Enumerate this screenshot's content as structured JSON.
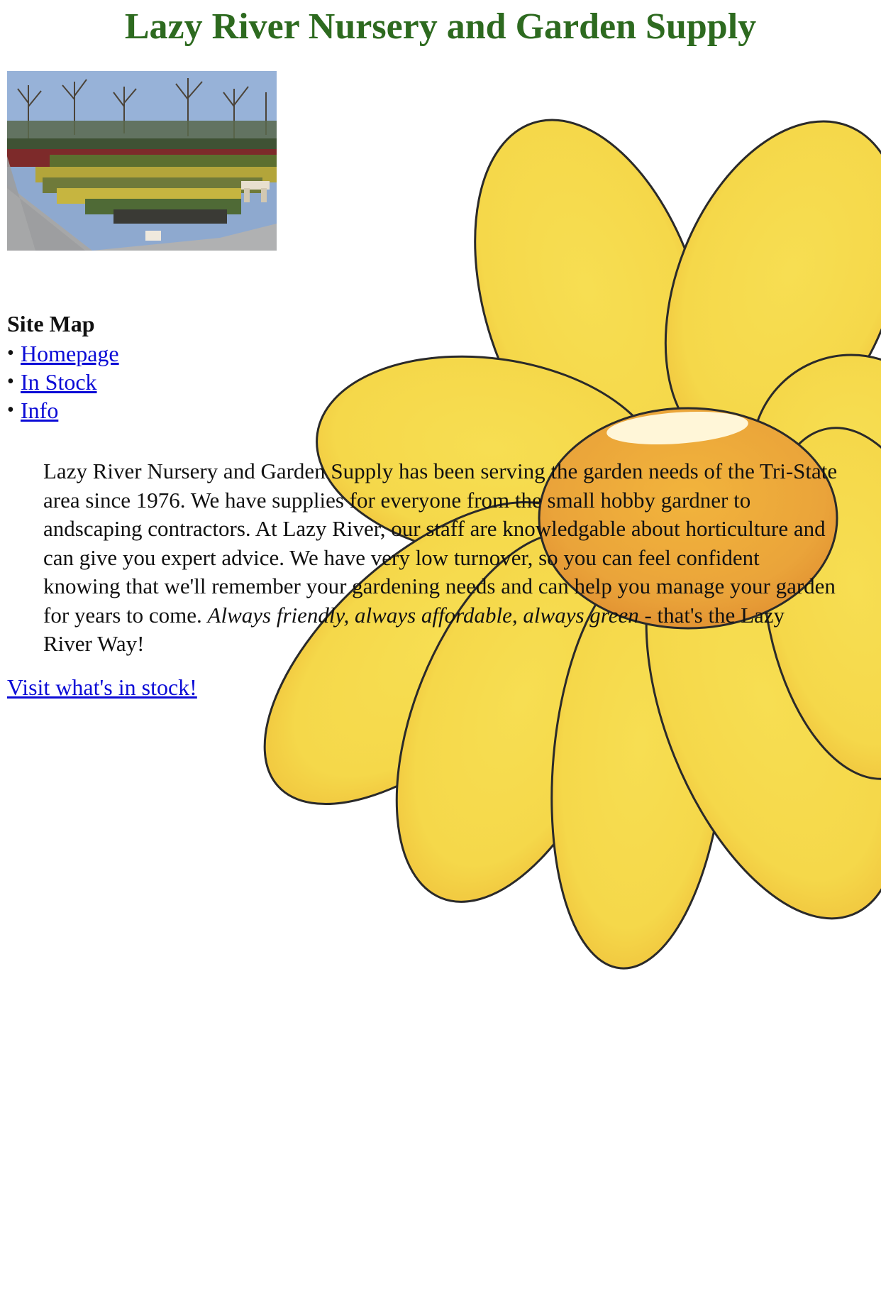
{
  "page": {
    "title": "Lazy River Nursery and Garden Supply"
  },
  "hero_image": {
    "alt": "Nursery with rows of potted plants"
  },
  "sitemap": {
    "heading": "Site Map",
    "items": [
      {
        "label": "Homepage"
      },
      {
        "label": "In Stock"
      },
      {
        "label": "Info"
      }
    ]
  },
  "blurb": {
    "text_main": "Lazy River Nursery and Garden Supply has been serving the garden needs of the Tri-State area since 1976. We have supplies for everyone from the small hobby gardner to andscaping contractors. At Lazy River, our staff are knowledgable about horticulture and can give you expert advice. We have very low turnover, so you can feel confident knowing that we'll remember your gardening needs and can help you manage your garden for years to come. ",
    "tagline": "Always friendly, always affordable, always green",
    "text_end": " - that's the Lazy River Way!"
  },
  "cta": {
    "label": "Visit what's in stock!"
  },
  "colors": {
    "title": "#2d6a1f",
    "link": "#0b0bd6",
    "petal": "#f5d94a",
    "petal_edge": "#f0bc3a",
    "center": "#e8a23a"
  }
}
